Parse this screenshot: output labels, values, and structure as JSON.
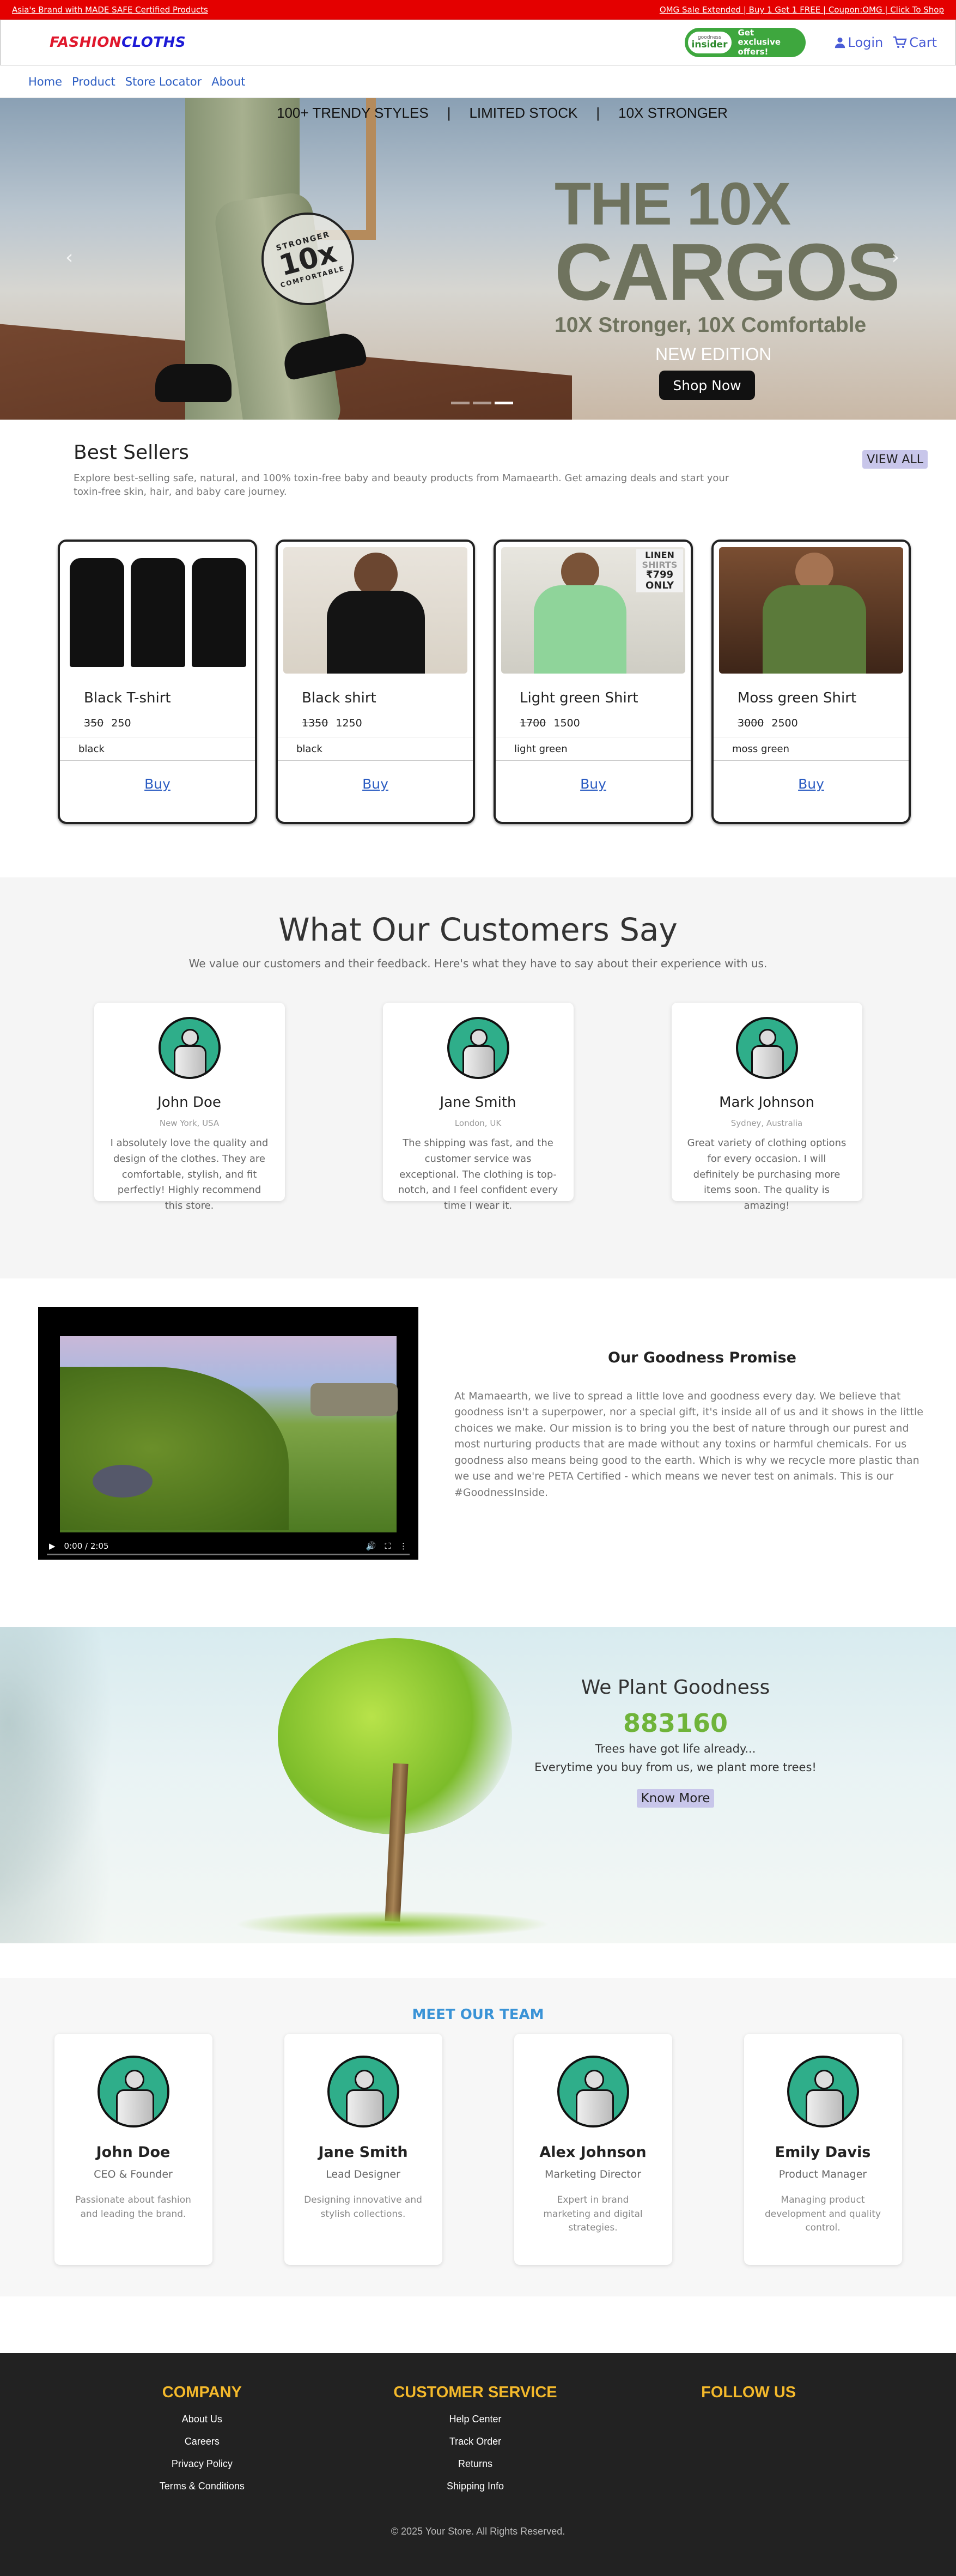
{
  "topbar": {
    "left": "Asia's Brand with MADE SAFE Certified Products",
    "right": "OMG Sale Extended | Buy 1 Get 1 FREE | Coupon:OMG | Click To Shop"
  },
  "header": {
    "logo_part1": "FASHION",
    "logo_part2": "CLOTHS",
    "insider_small": "goodness",
    "insider_brand": "insider",
    "insider_text": "Get exclusive offers!",
    "login": "Login",
    "cart": "Cart"
  },
  "nav": [
    "Home",
    "Product",
    "Store Locator",
    "About"
  ],
  "hero": {
    "tagline": [
      "100+ TRENDY STYLES",
      "|",
      "LIMITED STOCK",
      "|",
      "10X STRONGER"
    ],
    "badge_top": "STRONGER",
    "badge_mid": "10x",
    "badge_bottom": "COMFORTABLE",
    "title1": "THE 10X",
    "title2": "CARGOS",
    "title3": "10X Stronger, 10X Comfortable",
    "new_edition": "NEW EDITION",
    "cta": "Shop Now",
    "slide_count": 3,
    "active_slide": 3
  },
  "best_sellers": {
    "title": "Best Sellers",
    "description": "Explore best-selling safe, natural, and 100% toxin-free baby and beauty products from Mamaearth. Get amazing deals and start your toxin-free skin, hair, and baby care journey.",
    "view_all": "VIEW ALL",
    "products": [
      {
        "name": "Black T-shirt",
        "old_price": "350",
        "price": "250",
        "color": "black",
        "buy": "Buy",
        "swatch": "#1a1a1a"
      },
      {
        "name": "Black shirt",
        "old_price": "1350",
        "price": "1250",
        "color": "black",
        "buy": "Buy",
        "swatch": "#151515"
      },
      {
        "name": "Light green Shirt",
        "old_price": "1700",
        "price": "1500",
        "color": "light green",
        "buy": "Buy",
        "swatch": "#8fd49a"
      },
      {
        "name": "Moss green Shirt",
        "old_price": "3000",
        "price": "2500",
        "color": "moss green",
        "buy": "Buy",
        "swatch": "#5b7a3a"
      }
    ],
    "linen_badge": [
      "LINEN",
      "SHIRTS",
      "₹799",
      "ONLY"
    ]
  },
  "testimonials": {
    "title": "What Our Customers Say",
    "subtitle": "We value our customers and their feedback. Here's what they have to say about their experience with us.",
    "items": [
      {
        "name": "John Doe",
        "location": "New York, USA",
        "quote": "I absolutely love the quality and design of the clothes. They are comfortable, stylish, and fit perfectly! Highly recommend this store."
      },
      {
        "name": "Jane Smith",
        "location": "London, UK",
        "quote": "The shipping was fast, and the customer service was exceptional. The clothing is top-notch, and I feel confident every time I wear it."
      },
      {
        "name": "Mark Johnson",
        "location": "Sydney, Australia",
        "quote": "Great variety of clothing options for every occasion. I will definitely be purchasing more items soon. The quality is amazing!"
      }
    ]
  },
  "promise": {
    "title": "Our Goodness Promise",
    "text": "At Mamaearth, we live to spread a little love and goodness every day. We believe that goodness isn't a superpower, nor a special gift, it's inside all of us and it shows in the little choices we make. Our mission is to bring you the best of nature through our purest and most nurturing products that are made without any toxins or harmful chemicals. For us goodness also means being good to the earth. Which is why we recycle more plastic than we use and we're PETA Certified - which means we never test on animals. This is our #GoodnessInside.",
    "video_time": "0:00 / 2:05"
  },
  "plant": {
    "title": "We Plant Goodness",
    "count": "883160",
    "line1": "Trees have got life already...",
    "line2": "Everytime you buy from us, we plant more trees!",
    "cta": "Know More"
  },
  "team": {
    "title": "MEET OUR TEAM",
    "members": [
      {
        "name": "John Doe",
        "role": "CEO & Founder",
        "desc": "Passionate about fashion and leading the brand."
      },
      {
        "name": "Jane Smith",
        "role": "Lead Designer",
        "desc": "Designing innovative and stylish collections."
      },
      {
        "name": "Alex Johnson",
        "role": "Marketing Director",
        "desc": "Expert in brand marketing and digital strategies."
      },
      {
        "name": "Emily Davis",
        "role": "Product Manager",
        "desc": "Managing product development and quality control."
      }
    ]
  },
  "footer": {
    "company_title": "COMPANY",
    "company_links": [
      "About Us",
      "Careers",
      "Privacy Policy",
      "Terms & Conditions"
    ],
    "service_title": "CUSTOMER SERVICE",
    "service_links": [
      "Help Center",
      "Track Order",
      "Returns",
      "Shipping Info"
    ],
    "follow_title": "FOLLOW US",
    "copyright": "© 2025 Your Store. All Rights Reserved."
  },
  "colors": {
    "topbar": "#e40000",
    "link_blue": "#2b5cc2",
    "accent_green": "#6fb43a",
    "footer_heading": "#f4b92b",
    "team_heading": "#3a93d6",
    "button_lavender": "#c8c6ea"
  }
}
